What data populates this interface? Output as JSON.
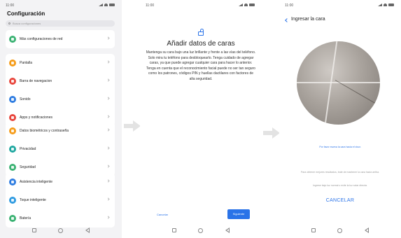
{
  "status": {
    "time": "11:00"
  },
  "settings": {
    "title": "Configuración",
    "search_placeholder": "Busca configuraciones",
    "items": [
      {
        "label": "Más configuraciones de red",
        "icon": "network-icon",
        "color": "#3bb273"
      },
      {
        "label": "Pantalla",
        "icon": "display-icon",
        "color": "#f59c1a"
      },
      {
        "label": "Barra de navegacion",
        "icon": "navigation-bar-icon",
        "color": "#e8453c"
      },
      {
        "label": "Sonido",
        "icon": "sound-icon",
        "color": "#2f7de1"
      },
      {
        "label": "Apps y notificaciones",
        "icon": "apps-icon",
        "color": "#e8453c"
      },
      {
        "label": "Datos biométricos y contraseña",
        "icon": "biometric-icon",
        "color": "#f59c1a"
      },
      {
        "label": "Privacidad",
        "icon": "privacy-icon",
        "color": "#1fa7a0"
      },
      {
        "label": "Seguridad",
        "icon": "security-icon",
        "color": "#3bb273"
      },
      {
        "label": "Asistencia inteligente",
        "icon": "assistant-icon",
        "color": "#2f7de1"
      },
      {
        "label": "Toque inteligente",
        "icon": "touch-icon",
        "color": "#2f9be1"
      },
      {
        "label": "Batería",
        "icon": "battery-icon",
        "color": "#3bb273"
      }
    ]
  },
  "face_intro": {
    "title": "Añadir datos de caras",
    "description": "Mantenga su cara bajo una luz brillante y frente a las vías del teléfono. Solo mira tu teléfono para desbloquearlo. Tenga cuidado de agregar caras, ya que puede agregar cualquier cara para hacer lo anterior. Tenga en cuenta que el reconocimiento facial puede no ser tan seguro como los patrones, códigos PIN y huellas dactilares con factores de alta seguridad.",
    "cancel_label": "Cancelar",
    "next_label": "Siguiente"
  },
  "face_scan": {
    "title": "Ingresar la cara",
    "hint": "Por favor mueva la cara hacia el visor.",
    "tip": "Para obtener mejores resultados, trate de mantener la cara hacia arriba.",
    "tip2": "Ingrese bajo luz normal o evite la luz solar directa.",
    "cancel_label": "CANCELAR"
  },
  "colors": {
    "accent": "#2a73e8",
    "settings_bg": "#f3f3f5"
  }
}
